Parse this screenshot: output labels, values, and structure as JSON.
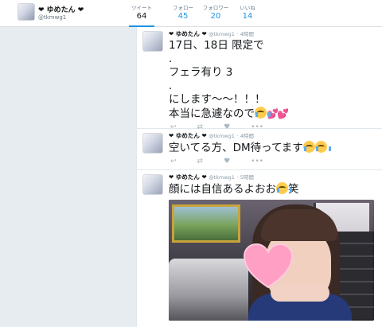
{
  "profile": {
    "name": "❤ ゆめたん ❤",
    "handle": "@tkmwg1"
  },
  "stats": [
    {
      "label": "ツイート",
      "value": "64",
      "active": true
    },
    {
      "label": "フォロー",
      "value": "45"
    },
    {
      "label": "フォロワー",
      "value": "20"
    },
    {
      "label": "いいね",
      "value": "14"
    }
  ],
  "tweets": [
    {
      "name": "❤ ゆめたん ❤",
      "handle": "@tkmwg1",
      "time": "4時間",
      "lines": [
        "17日、18日 限定で",
        ".",
        "フェラ有り 3",
        ".",
        "にします〜〜！！！",
        "本当に急遽なので"
      ]
    },
    {
      "name": "❤ ゆめたん ❤",
      "handle": "@tkmwg1",
      "time": "4時間",
      "lines": [
        "空いてる方、DM待ってます"
      ]
    },
    {
      "name": "❤ ゆめたん ❤",
      "handle": "@tkmwg1",
      "time": "5時間",
      "lines": [
        "顔には自信あるよおお",
        "笑"
      ]
    }
  ],
  "icons": {
    "reply": "reply-icon",
    "retweet": "retweet-icon",
    "like": "heart-icon",
    "crying": "loudly-crying-face-emoji",
    "hearts": "two-hearts-emoji"
  },
  "colors": {
    "accent": "#1b95e0",
    "heart_sticker": "#ff9fc4",
    "hearts_emoji": "#e0245e"
  }
}
